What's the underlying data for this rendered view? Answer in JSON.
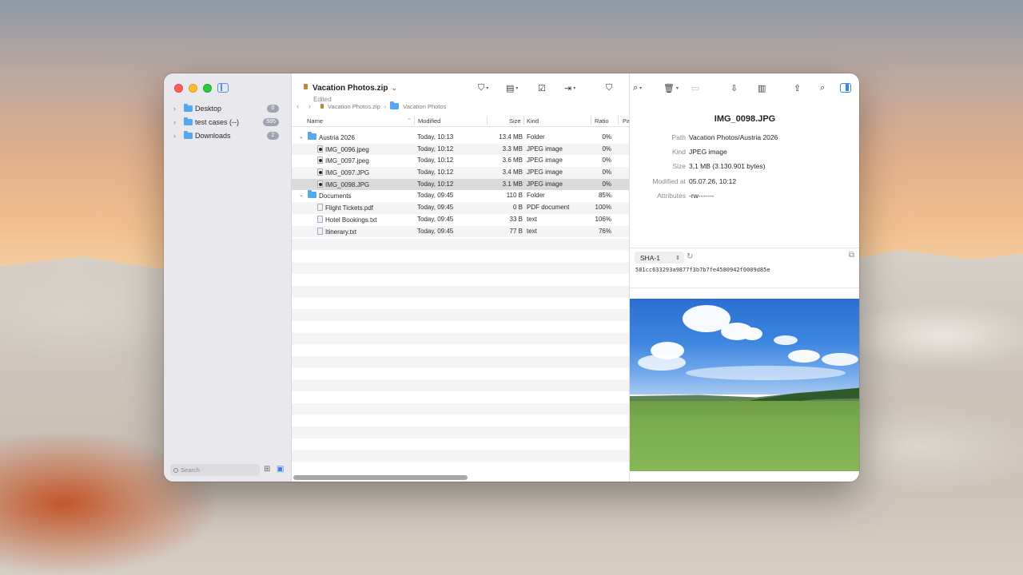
{
  "sidebar": {
    "items": [
      {
        "label": "Desktop",
        "badge": "0"
      },
      {
        "label": "test cases (--)",
        "badge": "595"
      },
      {
        "label": "Downloads",
        "badge": "2"
      }
    ],
    "search_placeholder": "Search"
  },
  "document": {
    "title": "Vacation Photos.zip",
    "subtitle": "Edited"
  },
  "breadcrumb": [
    "Vacation Photos.zip",
    "Vacation Photos"
  ],
  "table": {
    "columns": {
      "name": "Name",
      "modified": "Modified",
      "size": "Size",
      "kind": "Kind",
      "ratio": "Ratio",
      "extra": "Pa"
    },
    "rows": [
      {
        "name": "Austria 2026",
        "modified": "Today, 10:13",
        "size": "13.4 MB",
        "kind": "Folder",
        "ratio": "0%"
      },
      {
        "name": "IMG_0096.jpeg",
        "modified": "Today, 10:12",
        "size": "3.3 MB",
        "kind": "JPEG image",
        "ratio": "0%"
      },
      {
        "name": "IMG_0097.jpeg",
        "modified": "Today, 10:12",
        "size": "3.6 MB",
        "kind": "JPEG image",
        "ratio": "0%"
      },
      {
        "name": "IMG_0097.JPG",
        "modified": "Today, 10:12",
        "size": "3.4 MB",
        "kind": "JPEG image",
        "ratio": "0%"
      },
      {
        "name": "IMG_0098.JPG",
        "modified": "Today, 10:12",
        "size": "3.1 MB",
        "kind": "JPEG image",
        "ratio": "0%"
      },
      {
        "name": "Documents",
        "modified": "Today, 09:45",
        "size": "110 B",
        "kind": "Folder",
        "ratio": "85%"
      },
      {
        "name": "Flight Tickets.pdf",
        "modified": "Today, 09:45",
        "size": "0 B",
        "kind": "PDF document",
        "ratio": "100%"
      },
      {
        "name": "Hotel Bookings.txt",
        "modified": "Today, 09:45",
        "size": "33 B",
        "kind": "text",
        "ratio": "106%"
      },
      {
        "name": "Itinerary.txt",
        "modified": "Today, 09:45",
        "size": "77 B",
        "kind": "text",
        "ratio": "76%"
      }
    ]
  },
  "inspector": {
    "title": "IMG_0098.JPG",
    "props": [
      {
        "key": "Path",
        "value": "Vacation Photos/Austria 2026"
      },
      {
        "key": "Kind",
        "value": "JPEG image"
      },
      {
        "key": "Size",
        "value": "3,1 MB (3.130.901 bytes)"
      },
      {
        "key": "Modified at",
        "value": "05.07.26, 10:12"
      },
      {
        "key": "Attributes",
        "value": "-rw-------"
      }
    ],
    "hash_algorithm": "SHA-1",
    "hash_value": "581cc633293a9877f3b7b7fe4580942f0009d85e"
  }
}
